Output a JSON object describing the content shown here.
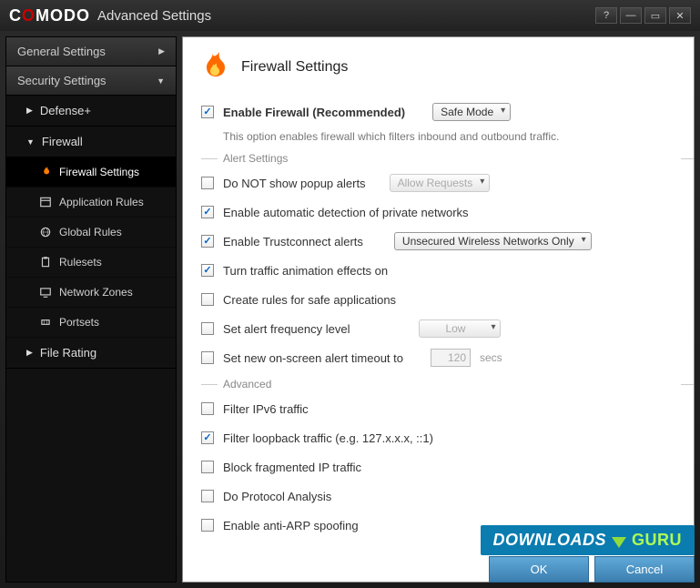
{
  "window": {
    "brand_left": "C",
    "brand_o": "O",
    "brand_rest": "MODO",
    "title": "Advanced Settings"
  },
  "sidebar": {
    "general": "General Settings",
    "security": "Security Settings",
    "defense": "Defense+",
    "firewall": "Firewall",
    "subs": {
      "fw_settings": "Firewall Settings",
      "app_rules": "Application Rules",
      "global_rules": "Global Rules",
      "rulesets": "Rulesets",
      "net_zones": "Network Zones",
      "portsets": "Portsets"
    },
    "file_rating": "File Rating"
  },
  "page": {
    "title": "Firewall Settings",
    "enable_label": "Enable Firewall (Recommended)",
    "enable_mode": "Safe Mode",
    "enable_desc": "This option enables firewall which filters inbound and outbound traffic.",
    "group_alert": "Alert Settings",
    "alerts": {
      "no_popup": "Do NOT show popup alerts",
      "no_popup_combo": "Allow Requests",
      "auto_detect": "Enable automatic detection of private networks",
      "trustconnect": "Enable Trustconnect alerts",
      "trustconnect_combo": "Unsecured Wireless Networks Only",
      "traffic_anim": "Turn traffic animation effects on",
      "safe_rules": "Create rules for safe applications",
      "freq_level": "Set alert frequency level",
      "freq_combo": "Low",
      "timeout_label": "Set new on-screen alert timeout to",
      "timeout_value": "120",
      "timeout_unit": "secs"
    },
    "group_adv": "Advanced",
    "adv": {
      "ipv6": "Filter IPv6 traffic",
      "loopback": "Filter loopback traffic (e.g. 127.x.x.x, ::1)",
      "fragmented": "Block fragmented IP traffic",
      "protocol": "Do Protocol Analysis",
      "arp": "Enable anti-ARP spoofing"
    }
  },
  "footer": {
    "ok": "OK",
    "cancel": "Cancel"
  },
  "watermark": {
    "left": "DOWNLOADS",
    "right": "GURU"
  }
}
